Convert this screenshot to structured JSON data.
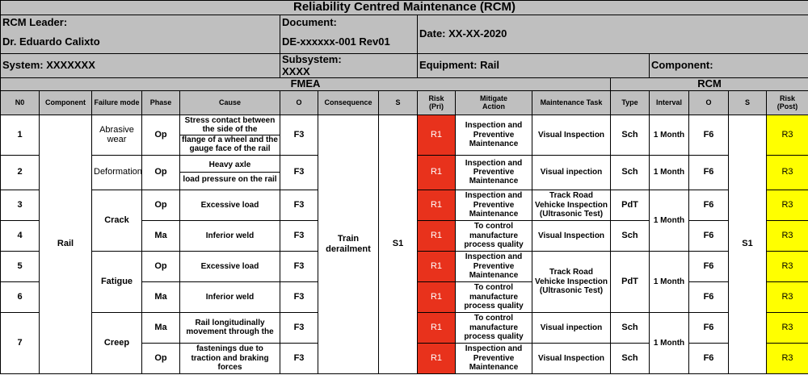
{
  "title": "Reliability Centred Maintenance (RCM)",
  "header": {
    "leader_label": "RCM Leader:",
    "leader_name": "Dr. Eduardo Calixto",
    "document_label": "Document:",
    "document_value": "DE-xxxxxx-001 Rev01",
    "date": "Date: XX-XX-2020",
    "system": "System: XXXXXXX",
    "subsystem_label": "Subsystem:",
    "subsystem_value": "XXXX",
    "equipment": "Equipment: Rail",
    "component": "Component:"
  },
  "sections": {
    "fmea": "FMEA",
    "rcm": "RCM"
  },
  "columns": {
    "no": "N0",
    "component": "Component",
    "failure_mode": "Failure mode",
    "phase": "Phase",
    "cause": "Cause",
    "o": "O",
    "consequence": "Consequence",
    "s": "S",
    "risk_pri_1": "Risk",
    "risk_pri_2": "(Pri)",
    "mitigate_1": "Mitigate",
    "mitigate_2": "Action",
    "task": "Maintenance Task",
    "type": "Type",
    "interval": "Interval",
    "o2": "O",
    "s2": "S",
    "risk_post_1": "Risk",
    "risk_post_2": "(Post)"
  },
  "spans": {
    "component": "Rail",
    "consequence": "Train derailment",
    "s": "S1",
    "s_post": "S1"
  },
  "failure_modes": {
    "abrasive": "Abrasive wear",
    "deformation": "Deformation",
    "crack": "Crack",
    "fatigue": "Fatigue",
    "creep": "Creep"
  },
  "intervals": {
    "r1": "1 Month",
    "r2": "1 Month",
    "crack": "1 Month",
    "fatigue": "1 Month",
    "creep": "1 Month"
  },
  "colors": {
    "header_gray": "#bfbfbf",
    "risk_pri": "#e8321c",
    "risk_post": "#ffff00"
  },
  "rows": [
    {
      "no": "1",
      "phase": "Op",
      "cause_a": "Stress contact between the side of the",
      "cause_b": "flange of a wheel and the gauge face of the rail",
      "o": "F3",
      "risk_pri": "R1",
      "mitigate": "Inspection and Preventive Maintenance",
      "task": "Visual Inspection",
      "type": "Sch",
      "o_post": "F6",
      "risk_post": "R3"
    },
    {
      "no": "2",
      "phase": "Op",
      "cause_a": "Heavy axle",
      "cause_b": "load pressure on the rail",
      "o": "F3",
      "risk_pri": "R1",
      "mitigate": "Inspection and Preventive Maintenance",
      "task": "Visual inpection",
      "type": "Sch",
      "o_post": "F6",
      "risk_post": "R3"
    },
    {
      "no": "3",
      "phase": "Op",
      "cause": "Excessive load",
      "o": "F3",
      "risk_pri": "R1",
      "mitigate": "Inspection and Preventive Maintenance",
      "task": "Track Road Vehicke Inspection (Ultrasonic Test)",
      "type": "PdT",
      "o_post": "F6",
      "risk_post": "R3"
    },
    {
      "no": "4",
      "phase": "Ma",
      "cause": "Inferior weld",
      "o": "F3",
      "risk_pri": "R1",
      "mitigate": "To control manufacture process quality",
      "task": "Visual Inspection",
      "type": "Sch",
      "o_post": "F6",
      "risk_post": "R3"
    },
    {
      "no": "5",
      "phase": "Op",
      "cause": "Excessive load",
      "o": "F3",
      "risk_pri": "R1",
      "mitigate": "Inspection and Preventive Maintenance",
      "o_post": "F6",
      "risk_post": "R3"
    },
    {
      "no": "6",
      "phase": "Ma",
      "cause": "Inferior weld",
      "o": "F3",
      "risk_pri": "R1",
      "mitigate": "To control manufacture process quality",
      "o_post": "F6",
      "risk_post": "R3"
    },
    {
      "phase": "Ma",
      "cause": "Rail longitudinally movement through the",
      "o": "F3",
      "risk_pri": "R1",
      "mitigate": "To control manufacture process quality",
      "task": "Visual inpection",
      "type": "Sch",
      "o_post": "F6",
      "risk_post": "R3"
    },
    {
      "phase": "Op",
      "cause": "fastenings due to traction and braking forces",
      "o": "F3",
      "risk_pri": "R1",
      "mitigate": "Inspection and Preventive Maintenance",
      "task": "Visual Inspection",
      "type": "Sch",
      "o_post": "F6",
      "risk_post": "R3"
    }
  ],
  "fatigue_task": {
    "task": "Track Road Vehicke Inspection (Ultrasonic Test)",
    "type": "PdT"
  },
  "row7_no": "7"
}
